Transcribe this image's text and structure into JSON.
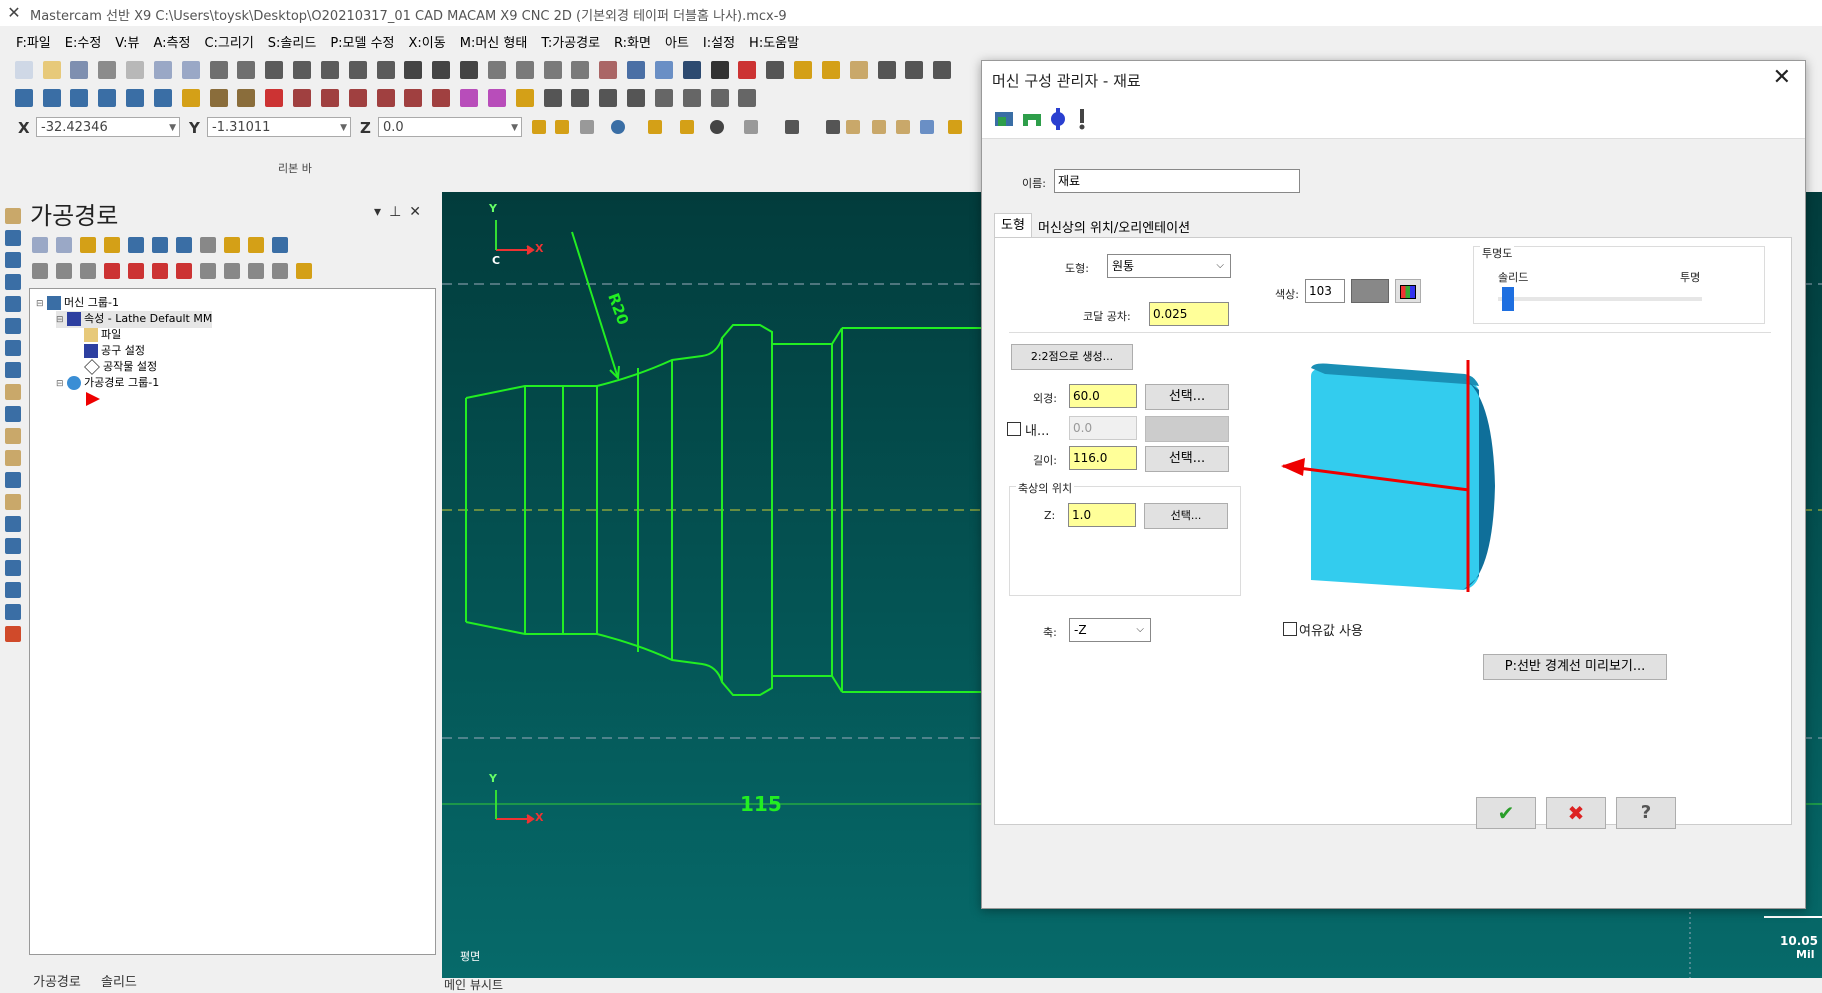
{
  "window": {
    "title": "Mastercam 선반 X9  C:\\Users\\toysk\\Desktop\\O20210317_01 CAD MACAM X9 CNC 2D (기본외경 테이퍼 더블홈 나사).mcx-9"
  },
  "menu": {
    "items": [
      "F:파일",
      "E:수정",
      "V:뷰",
      "A:측정",
      "C:그리기",
      "S:솔리드",
      "P:모델 수정",
      "X:이동",
      "M:머신 형태",
      "T:가공경로",
      "R:화면",
      "아트",
      "I:설정",
      "H:도움말"
    ]
  },
  "coords": {
    "x_label": "X",
    "x_value": "-32.42346",
    "y_label": "Y",
    "y_value": "-1.31011",
    "z_label": "Z",
    "z_value": "0.0"
  },
  "ribbon": {
    "label": "리본 바"
  },
  "ops_manager": {
    "title": "가공경로",
    "tree": {
      "machine_group": "머신 그룹-1",
      "properties": "속성 - Lathe Default MM",
      "files": "파일",
      "tool_settings": "공구 설정",
      "stock_settings": "공작물 설정",
      "toolpath_group": "가공경로 그룹-1"
    },
    "tabs": [
      "가공경로",
      "솔리드"
    ]
  },
  "viewport": {
    "axis_y": "Y",
    "axis_x": "X",
    "axis_c": "C",
    "radius_label": "R20",
    "dim_label": "115",
    "plane_label": "평면",
    "scale_value": "10.05",
    "scale_unit": "Mil",
    "bottom_tab": "메인 뷰시트"
  },
  "dialog": {
    "title": "머신 구성 관리자 - 재료",
    "close": "✕",
    "name_label": "이름:",
    "name_value": "재료",
    "tabs": [
      "도형",
      "머신상의 위치/오리엔테이션"
    ],
    "shape_label": "도형:",
    "shape_value": "원통",
    "tolerance_label": "코달 공차:",
    "tolerance_value": "0.025",
    "color_label": "색상:",
    "color_value": "103",
    "transparency": {
      "title": "투명도",
      "solid": "솔리드",
      "transparent": "투명",
      "value": 0.05
    },
    "make_from_2pts": "2:2점으로 생성...",
    "od_label": "외경:",
    "od_value": "60.0",
    "id_checkbox": "내...",
    "id_value": "0.0",
    "length_label": "길이:",
    "length_value": "116.0",
    "axis_pos_title": "축상의 위치",
    "z_label": "Z:",
    "z_value": "1.0",
    "select_label": "선택...",
    "axis_label": "축:",
    "axis_value": "-Z",
    "use_margin": "여유값 사용",
    "preview_btn": "P:선반 경계선 미리보기...",
    "ok": "✔",
    "cancel": "✖",
    "help": "?"
  },
  "colors": {
    "stock_cyan": "#33ccee",
    "geometry_green": "#22ee22",
    "viewport_top": "#023c3c",
    "viewport_bottom": "#066a6a",
    "highlight_yellow": "#ffff99"
  }
}
